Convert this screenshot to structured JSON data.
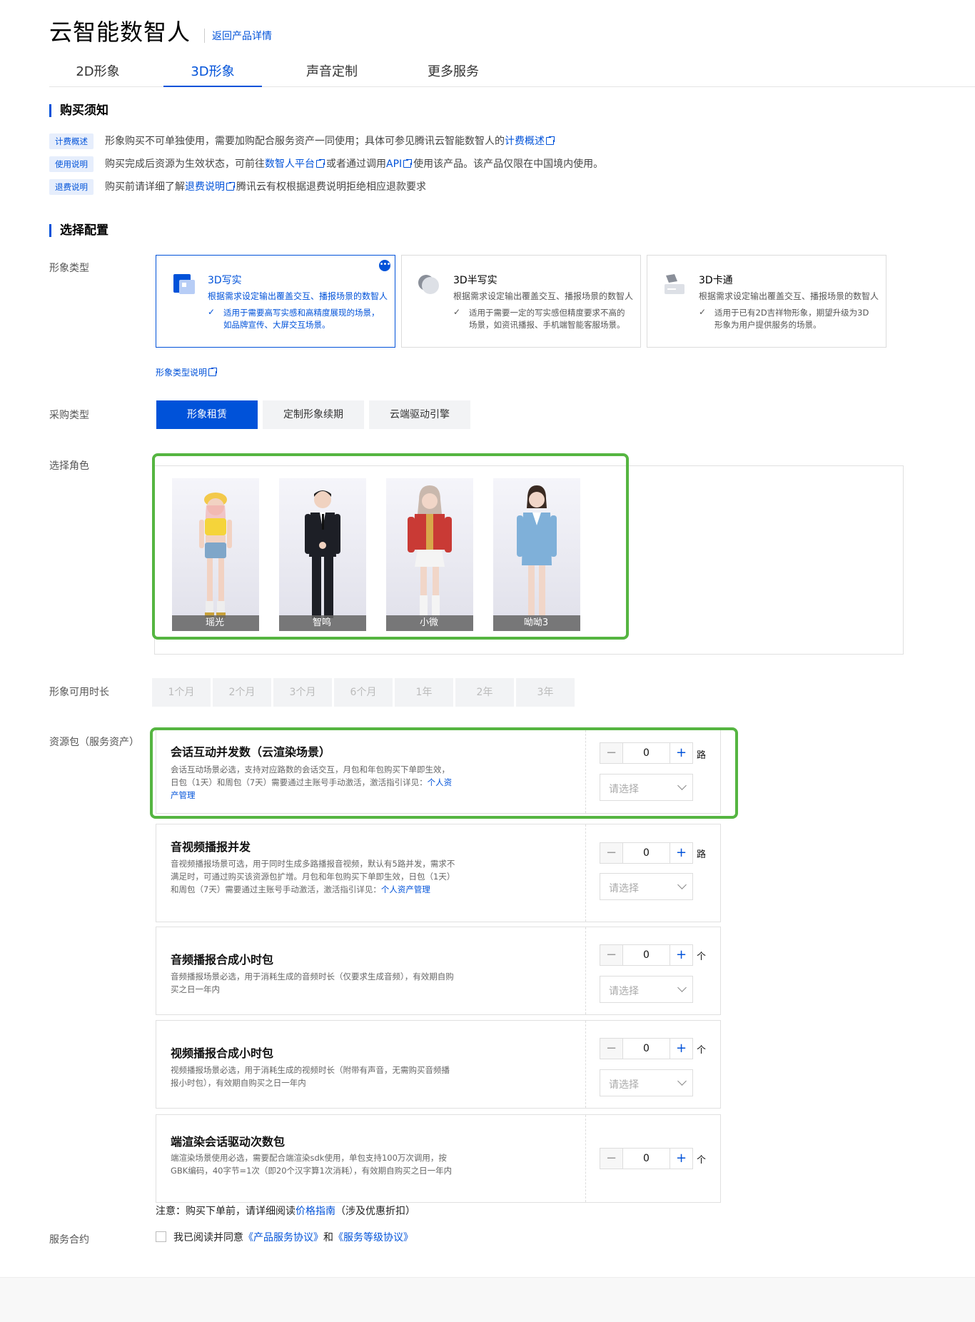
{
  "header": {
    "title": "云智能数智人",
    "back_link": "返回产品详情"
  },
  "tabs": [
    {
      "label": "2D形象"
    },
    {
      "label": "3D形象"
    },
    {
      "label": "声音定制"
    },
    {
      "label": "更多服务"
    }
  ],
  "purchase_notice": {
    "title": "购买须知",
    "rows": [
      {
        "tag": "计费概述",
        "text": "形象购买不可单独使用，需要加购配合服务资产一同使用；具体可参见腾讯云智能数智人的",
        "link": "计费概述",
        "after": ""
      },
      {
        "tag": "使用说明",
        "text": "购买完成后资源为生效状态，可前往",
        "link": "数智人平台",
        "mid": "或者通过调用",
        "link2": "API",
        "after": "使用该产品。该产品仅限在中国境内使用。"
      },
      {
        "tag": "退费说明",
        "text": "购买前请详细了解",
        "link": "退费说明",
        "after": "腾讯云有权根据退费说明拒绝相应退款要求"
      }
    ]
  },
  "config": {
    "title": "选择配置",
    "avatar_type_label": "形象类型",
    "avatar_types": [
      {
        "title": "3D写实",
        "desc": "根据需求设定输出覆盖交互、播报场景的数智人",
        "feature": "适用于需要高写实感和高精度展现的场景，如品牌宣传、大屏交互场景。",
        "more": "•••"
      },
      {
        "title": "3D半写实",
        "desc": "根据需求设定输出覆盖交互、播报场景的数智人",
        "feature": "适用于需要一定的写实感但精度要求不高的场景，如资讯播报、手机端智能客服场景。"
      },
      {
        "title": "3D卡通",
        "desc": "根据需求设定输出覆盖交互、播报场景的数智人",
        "feature": "适用于已有2D吉祥物形象，期望升级为3D形象为用户提供服务的场景。"
      }
    ],
    "avatar_type_link": "形象类型说明",
    "purchase_type_label": "采购类型",
    "purchase_types": [
      "形象租赁",
      "定制形象续期",
      "云端驱动引擎"
    ],
    "role_label": "选择角色",
    "roles": [
      {
        "name": "瑶光"
      },
      {
        "name": "智鸣"
      },
      {
        "name": "小微"
      },
      {
        "name": "呦呦3"
      }
    ],
    "duration_label": "形象可用时长",
    "durations": [
      "1个月",
      "2个月",
      "3个月",
      "6个月",
      "1年",
      "2年",
      "3年"
    ],
    "resource_label": "资源包（服务资产）",
    "packages": [
      {
        "name": "会话互动并发数（云渲染场景）",
        "desc": "会话互动场景必选，支持对应路数的会话交互，月包和年包购买下单即生效，日包（1天）和周包（7天）需要通过主账号手动激活，激活指引详见：",
        "link": "个人资产管理",
        "value": "0",
        "unit": "路",
        "select": "请选择"
      },
      {
        "name": "音视频播报并发",
        "desc": "音视频播报场景可选，用于同时生成多路播报音视频，默认有5路并发，需求不满足时，可通过购买该资源包扩增。月包和年包购买下单即生效，日包（1天）和周包（7天）需要通过主账号手动激活，激活指引详见：",
        "link": "个人资产管理",
        "value": "0",
        "unit": "路",
        "select": "请选择"
      },
      {
        "name": "音频播报合成小时包",
        "desc": "音频播报场景必选，用于消耗生成的音频时长（仅要求生成音频），有效期自购买之日一年内",
        "value": "0",
        "unit": "个",
        "select": "请选择"
      },
      {
        "name": "视频播报合成小时包",
        "desc": "视频播报场景必选，用于消耗生成的视频时长（附带有声音，无需购买音频播报小时包），有效期自购买之日一年内",
        "value": "0",
        "unit": "个",
        "select": "请选择"
      },
      {
        "name": "端渲染会话驱动次数包",
        "desc": "端渲染场景使用必选，需要配合端渲染sdk使用，单包支持100万次调用，按GBK编码，40字节=1次（即20个汉字算1次消耗），有效期自购买之日一年内",
        "value": "0",
        "unit": "个"
      }
    ],
    "note_prefix": "注意：购买下单前，请详细阅读",
    "note_link": "价格指南",
    "note_suffix": "（涉及优惠折扣）",
    "agreement_label": "服务合约",
    "agreement_prefix": "我已阅读并同意",
    "agreement_link1": "《产品服务协议》",
    "agreement_and": "和",
    "agreement_link2": "《服务等级协议》"
  },
  "colors": {
    "accent": "#0052d9",
    "highlight": "#55b541"
  }
}
